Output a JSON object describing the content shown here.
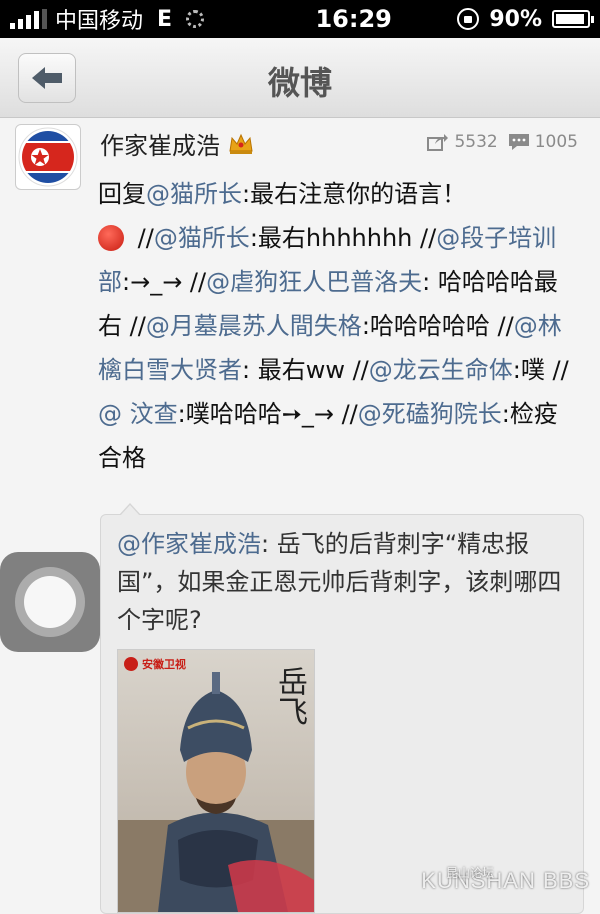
{
  "status_bar": {
    "carrier": "中国移动",
    "network": "E",
    "time": "16:29",
    "battery": "90%"
  },
  "nav": {
    "title": "微博"
  },
  "post": {
    "author": "作家崔成浩",
    "reposts": "5532",
    "comments": "1005",
    "text": {
      "p1": "回复",
      "m1": "@猫所长",
      "p2": ":最右注意你的语言！",
      "p3": " //",
      "m2": "@猫所长",
      "p4": ":最右hhhhhhh //",
      "m3": "@段子培训部",
      "p5": ":→_→ //",
      "m4": "@虐狗狂人巴普洛夫",
      "p6": ": 哈哈哈哈最右 //",
      "m5": "@月墓晨苏人間失格",
      "p7": ":哈哈哈哈哈 //",
      "m6": "@林檎白雪大贤者",
      "p8": ": 最右ww //",
      "m7": "@龙云生命体",
      "p9": ":噗 //",
      "m8": "@ 汶查",
      "p10": ":噗哈哈哈➙_→ //",
      "m9": "@死磕狗院长",
      "p11": ":检疫合格"
    }
  },
  "quote": {
    "mention": "@作家崔成浩",
    "text": ": 岳飞的后背刺字“精忠报国”，如果金正恩元帅后背刺字，该刺哪四个字呢?",
    "image": {
      "channel": "安徽卫视",
      "calligraphy": "岳飞"
    }
  },
  "watermark": {
    "cn": "昆山论坛",
    "en": "KUNSHAN BBS"
  }
}
